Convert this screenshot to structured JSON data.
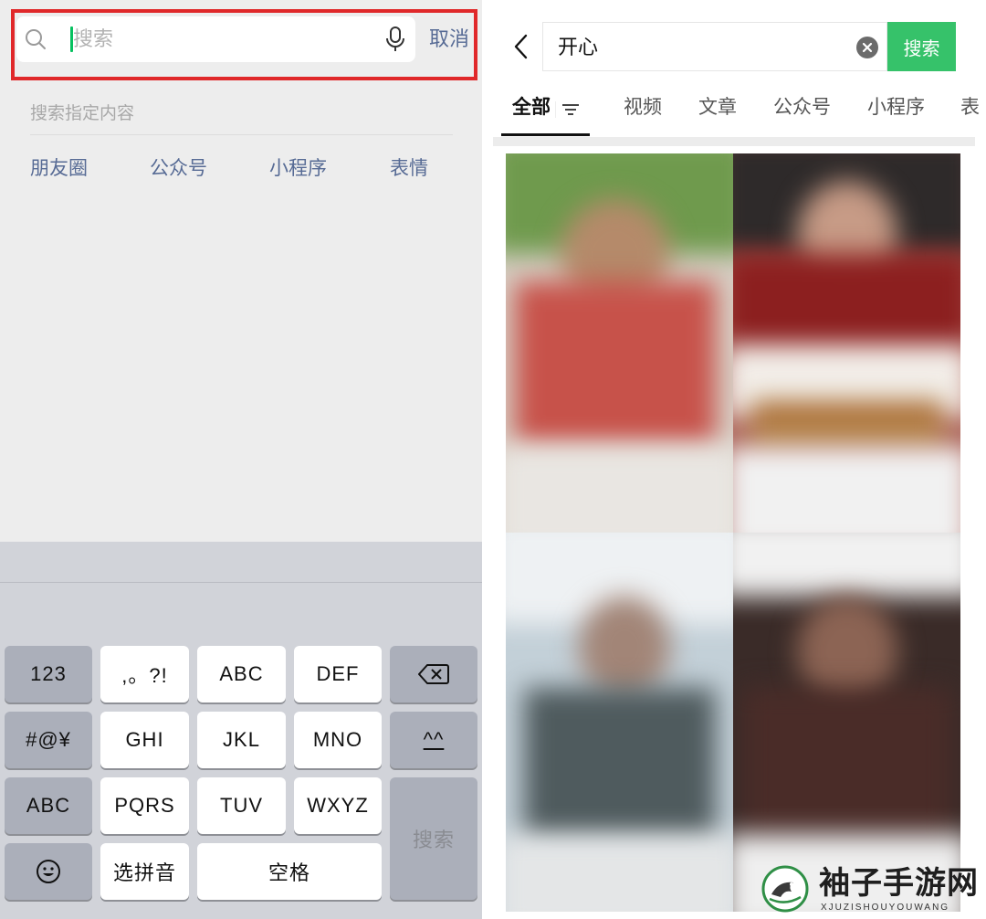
{
  "left": {
    "search": {
      "placeholder": "搜索",
      "cancel_label": "取消"
    },
    "hint": "搜索指定内容",
    "categories": [
      "朋友圈",
      "公众号",
      "小程序",
      "表情"
    ],
    "keyboard": {
      "rows": [
        [
          "123",
          ",。?!",
          "ABC",
          "DEF",
          "delete-icon"
        ],
        [
          "#@¥",
          "GHI",
          "JKL",
          "MNO",
          "^^"
        ],
        [
          "ABC",
          "PQRS",
          "TUV",
          "WXYZ",
          "搜索"
        ],
        [
          "emoji-icon",
          "选拼音",
          "空格"
        ]
      ],
      "keys": {
        "k123": "123",
        "punct": ",。?!",
        "abc": "ABC",
        "def": "DEF",
        "sym": "#@¥",
        "ghi": "GHI",
        "jkl": "JKL",
        "mno": "MNO",
        "caret": "^^",
        "abc2": "ABC",
        "pqrs": "PQRS",
        "tuv": "TUV",
        "wxyz": "WXYZ",
        "search": "搜索",
        "pinyin": "选拼音",
        "space": "空格"
      }
    }
  },
  "right": {
    "query": "开心",
    "search_button": "搜索",
    "tabs": [
      "全部",
      "视频",
      "文章",
      "公众号",
      "小程序",
      "表"
    ],
    "active_tab": "全部"
  },
  "watermark": {
    "title": "袖子手游网",
    "subtitle": "XJUZISHOUYOUWANG"
  },
  "colors": {
    "highlight_border": "#e0282a",
    "accent_green": "#36c26a",
    "link_blue": "#576b95"
  }
}
